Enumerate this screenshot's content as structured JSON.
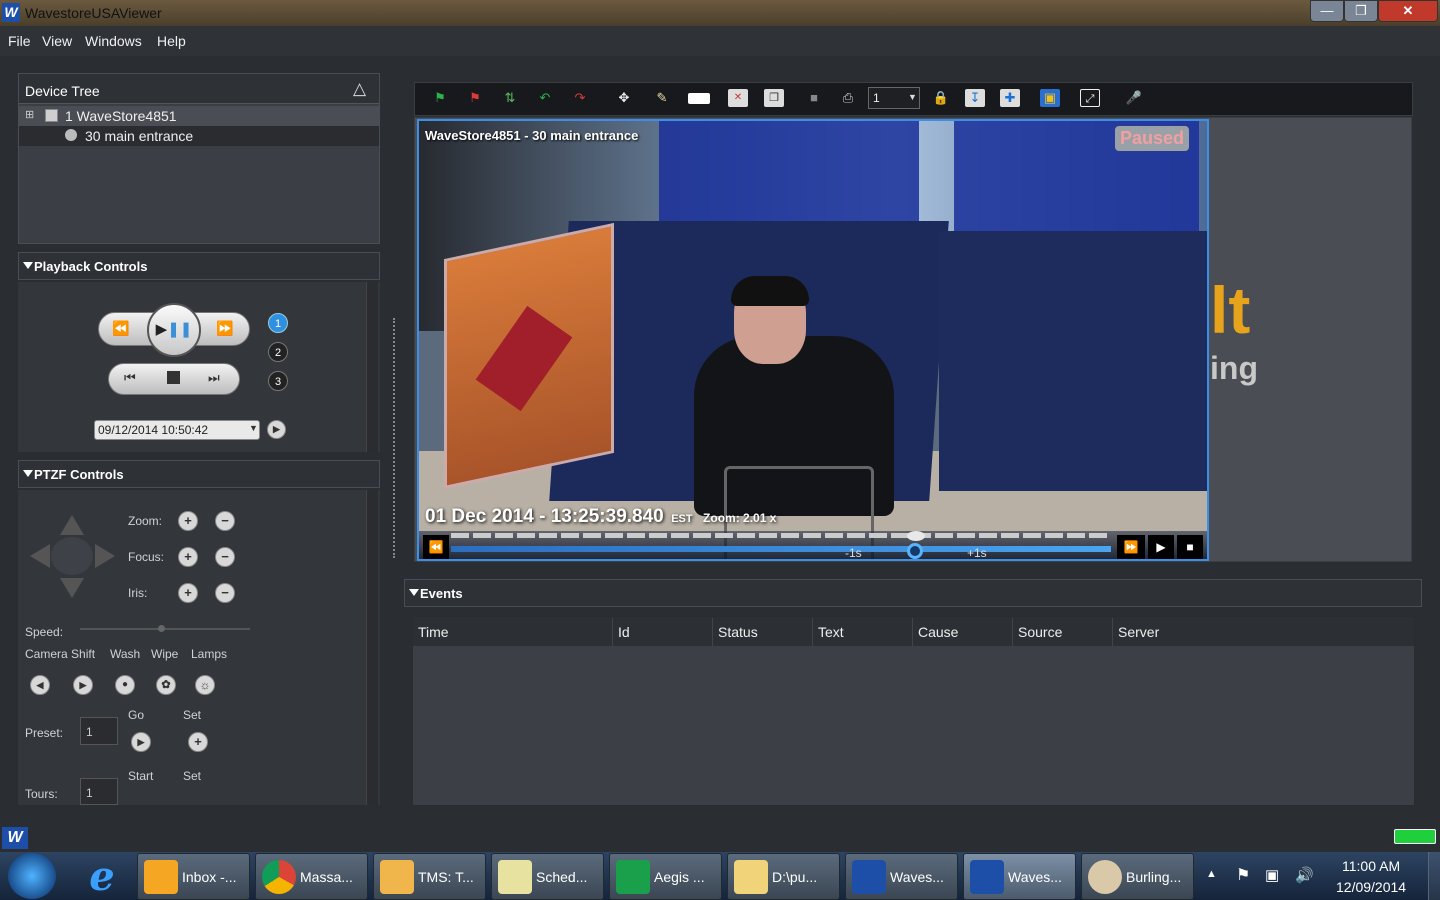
{
  "window": {
    "title": "WavestoreUSAViewer"
  },
  "menu": [
    "File",
    "View",
    "Windows",
    "Help"
  ],
  "device_tree": {
    "title": "Device Tree",
    "items": [
      "1 WaveStore4851",
      "30 main entrance"
    ]
  },
  "playback": {
    "title": "Playback Controls",
    "speeds": [
      "1",
      "2",
      "3"
    ],
    "datetime": "09/12/2014 10:50:42"
  },
  "ptzf": {
    "title": "PTZF Controls",
    "zoom_label": "Zoom:",
    "focus_label": "Focus:",
    "iris_label": "Iris:",
    "speed_label": "Speed:",
    "actions": [
      "Camera Shift",
      "Wash",
      "Wipe",
      "Lamps"
    ],
    "preset_label": "Preset:",
    "preset_value": "1",
    "go_label": "Go",
    "set_label": "Set",
    "tours_label": "Tours:",
    "tours_value": "1",
    "start_label": "Start",
    "set2_label": "Set"
  },
  "toolbar": {
    "channel_value": "1"
  },
  "video": {
    "camera_title": "WaveStore4851 - 30 main entrance",
    "status": "Paused",
    "timestamp": "01 Dec 2014 - 13:25:39.840",
    "tz": "EST",
    "zoom": "Zoom: 2.01 x",
    "minus_label": "-1s",
    "plus_label": "+1s"
  },
  "background_text": {
    "t1": "lt",
    "t2": "ing"
  },
  "events": {
    "title": "Events",
    "columns": [
      "Time",
      "Id",
      "Status",
      "Text",
      "Cause",
      "Source",
      "Server"
    ]
  },
  "taskbar": {
    "items": [
      "Inbox -...",
      "Massa...",
      "TMS: T...",
      "Sched...",
      "Aegis ...",
      "D:\\pu...",
      "Waves...",
      "Waves...",
      "Burling..."
    ],
    "time": "11:00 AM",
    "date": "12/09/2014"
  }
}
